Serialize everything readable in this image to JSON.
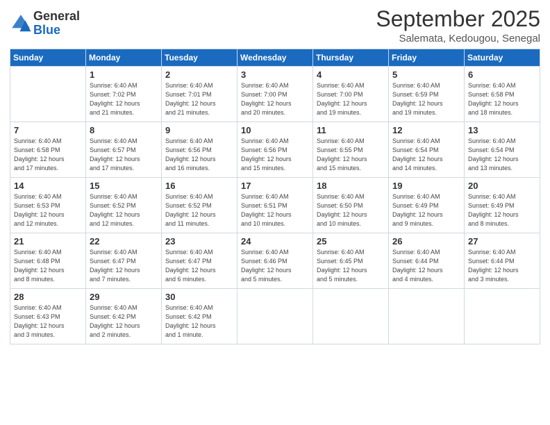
{
  "header": {
    "logo": {
      "general": "General",
      "blue": "Blue"
    },
    "title": "September 2025",
    "location": "Salemata, Kedougou, Senegal"
  },
  "weekdays": [
    "Sunday",
    "Monday",
    "Tuesday",
    "Wednesday",
    "Thursday",
    "Friday",
    "Saturday"
  ],
  "weeks": [
    [
      {
        "day": "",
        "info": ""
      },
      {
        "day": "1",
        "info": "Sunrise: 6:40 AM\nSunset: 7:02 PM\nDaylight: 12 hours\nand 21 minutes."
      },
      {
        "day": "2",
        "info": "Sunrise: 6:40 AM\nSunset: 7:01 PM\nDaylight: 12 hours\nand 21 minutes."
      },
      {
        "day": "3",
        "info": "Sunrise: 6:40 AM\nSunset: 7:00 PM\nDaylight: 12 hours\nand 20 minutes."
      },
      {
        "day": "4",
        "info": "Sunrise: 6:40 AM\nSunset: 7:00 PM\nDaylight: 12 hours\nand 19 minutes."
      },
      {
        "day": "5",
        "info": "Sunrise: 6:40 AM\nSunset: 6:59 PM\nDaylight: 12 hours\nand 19 minutes."
      },
      {
        "day": "6",
        "info": "Sunrise: 6:40 AM\nSunset: 6:58 PM\nDaylight: 12 hours\nand 18 minutes."
      }
    ],
    [
      {
        "day": "7",
        "info": "Sunrise: 6:40 AM\nSunset: 6:58 PM\nDaylight: 12 hours\nand 17 minutes."
      },
      {
        "day": "8",
        "info": "Sunrise: 6:40 AM\nSunset: 6:57 PM\nDaylight: 12 hours\nand 17 minutes."
      },
      {
        "day": "9",
        "info": "Sunrise: 6:40 AM\nSunset: 6:56 PM\nDaylight: 12 hours\nand 16 minutes."
      },
      {
        "day": "10",
        "info": "Sunrise: 6:40 AM\nSunset: 6:56 PM\nDaylight: 12 hours\nand 15 minutes."
      },
      {
        "day": "11",
        "info": "Sunrise: 6:40 AM\nSunset: 6:55 PM\nDaylight: 12 hours\nand 15 minutes."
      },
      {
        "day": "12",
        "info": "Sunrise: 6:40 AM\nSunset: 6:54 PM\nDaylight: 12 hours\nand 14 minutes."
      },
      {
        "day": "13",
        "info": "Sunrise: 6:40 AM\nSunset: 6:54 PM\nDaylight: 12 hours\nand 13 minutes."
      }
    ],
    [
      {
        "day": "14",
        "info": "Sunrise: 6:40 AM\nSunset: 6:53 PM\nDaylight: 12 hours\nand 12 minutes."
      },
      {
        "day": "15",
        "info": "Sunrise: 6:40 AM\nSunset: 6:52 PM\nDaylight: 12 hours\nand 12 minutes."
      },
      {
        "day": "16",
        "info": "Sunrise: 6:40 AM\nSunset: 6:52 PM\nDaylight: 12 hours\nand 11 minutes."
      },
      {
        "day": "17",
        "info": "Sunrise: 6:40 AM\nSunset: 6:51 PM\nDaylight: 12 hours\nand 10 minutes."
      },
      {
        "day": "18",
        "info": "Sunrise: 6:40 AM\nSunset: 6:50 PM\nDaylight: 12 hours\nand 10 minutes."
      },
      {
        "day": "19",
        "info": "Sunrise: 6:40 AM\nSunset: 6:49 PM\nDaylight: 12 hours\nand 9 minutes."
      },
      {
        "day": "20",
        "info": "Sunrise: 6:40 AM\nSunset: 6:49 PM\nDaylight: 12 hours\nand 8 minutes."
      }
    ],
    [
      {
        "day": "21",
        "info": "Sunrise: 6:40 AM\nSunset: 6:48 PM\nDaylight: 12 hours\nand 8 minutes."
      },
      {
        "day": "22",
        "info": "Sunrise: 6:40 AM\nSunset: 6:47 PM\nDaylight: 12 hours\nand 7 minutes."
      },
      {
        "day": "23",
        "info": "Sunrise: 6:40 AM\nSunset: 6:47 PM\nDaylight: 12 hours\nand 6 minutes."
      },
      {
        "day": "24",
        "info": "Sunrise: 6:40 AM\nSunset: 6:46 PM\nDaylight: 12 hours\nand 5 minutes."
      },
      {
        "day": "25",
        "info": "Sunrise: 6:40 AM\nSunset: 6:45 PM\nDaylight: 12 hours\nand 5 minutes."
      },
      {
        "day": "26",
        "info": "Sunrise: 6:40 AM\nSunset: 6:44 PM\nDaylight: 12 hours\nand 4 minutes."
      },
      {
        "day": "27",
        "info": "Sunrise: 6:40 AM\nSunset: 6:44 PM\nDaylight: 12 hours\nand 3 minutes."
      }
    ],
    [
      {
        "day": "28",
        "info": "Sunrise: 6:40 AM\nSunset: 6:43 PM\nDaylight: 12 hours\nand 3 minutes."
      },
      {
        "day": "29",
        "info": "Sunrise: 6:40 AM\nSunset: 6:42 PM\nDaylight: 12 hours\nand 2 minutes."
      },
      {
        "day": "30",
        "info": "Sunrise: 6:40 AM\nSunset: 6:42 PM\nDaylight: 12 hours\nand 1 minute."
      },
      {
        "day": "",
        "info": ""
      },
      {
        "day": "",
        "info": ""
      },
      {
        "day": "",
        "info": ""
      },
      {
        "day": "",
        "info": ""
      }
    ]
  ]
}
